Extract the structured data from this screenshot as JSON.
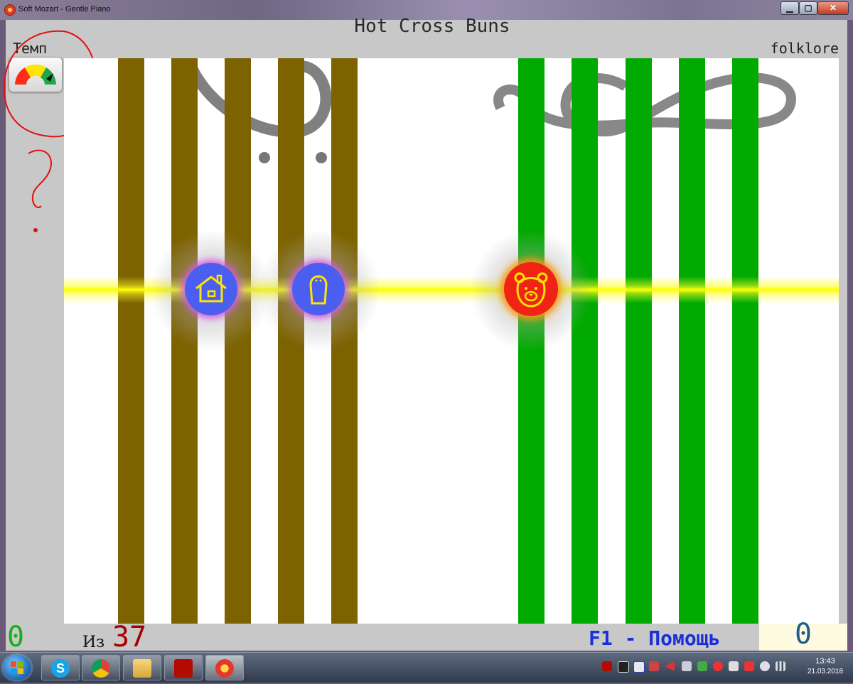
{
  "window": {
    "title": "Soft Mozart - Gentle Piano",
    "controls": {
      "minimize": "▁",
      "maximize": "▢",
      "close": "✕"
    }
  },
  "header": {
    "song_title": "Hot Cross Buns",
    "tempo_label": "Темп",
    "genre_label": "folklore"
  },
  "tempo_gauge": {
    "colors": [
      "#ff2a1a",
      "#ffe500",
      "#1ea84a"
    ],
    "needle_icon": "tempo-needle-icon"
  },
  "lanes": {
    "brown_color": "#7d6200",
    "green_color": "#00aa00",
    "brown_count": 5,
    "green_count": 5
  },
  "notes": [
    {
      "icon": "house-icon",
      "color": "#4a5ff0"
    },
    {
      "icon": "bell-icon",
      "color": "#4a5ff0"
    },
    {
      "icon": "bear-icon",
      "color": "#f02414"
    }
  ],
  "footer": {
    "score_left": "0",
    "of_label": "Из",
    "total_count": "37",
    "help_hint": "F1 - Помощь",
    "score_right": "0"
  },
  "taskbar": {
    "apps": [
      "skype-icon",
      "chrome-icon",
      "file-explorer-icon",
      "acrobat-icon",
      "soft-mozart-icon"
    ],
    "clock_time": "13:43",
    "clock_date": "21.03.2018"
  }
}
